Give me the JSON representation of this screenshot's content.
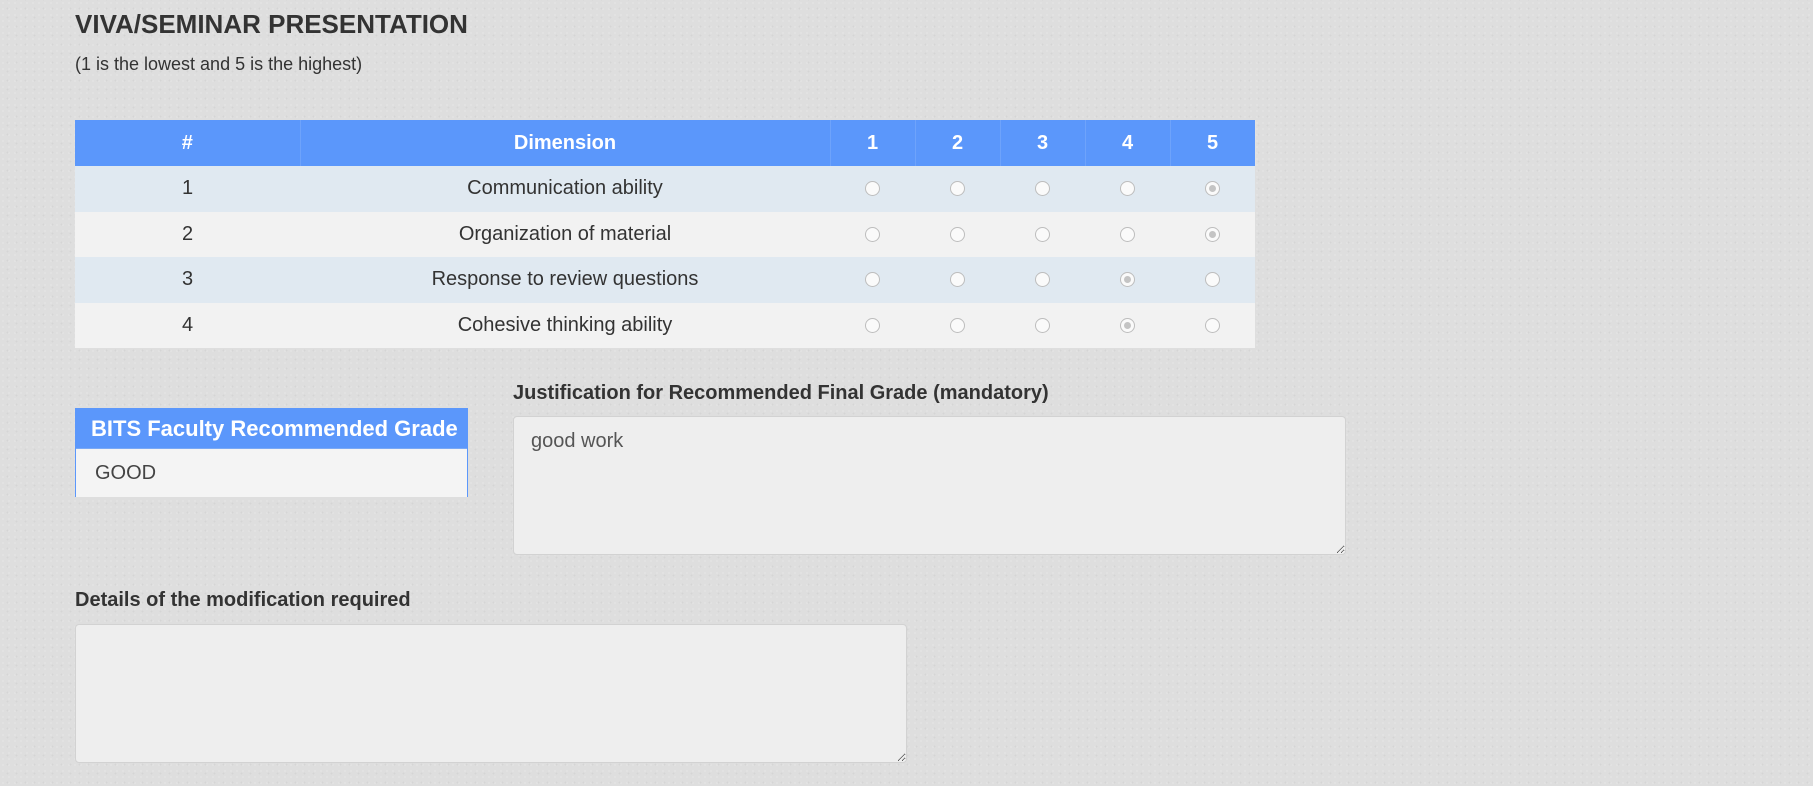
{
  "section": {
    "title": "VIVA/SEMINAR PRESENTATION",
    "subtitle": "(1 is the lowest and 5 is the highest)"
  },
  "rating_table": {
    "columns": [
      "#",
      "Dimension",
      "1",
      "2",
      "3",
      "4",
      "5"
    ],
    "rows": [
      {
        "number": "1",
        "dimension": "Communication ability",
        "selected": 5
      },
      {
        "number": "2",
        "dimension": "Organization of material",
        "selected": 5
      },
      {
        "number": "3",
        "dimension": "Response to review questions",
        "selected": 4
      },
      {
        "number": "4",
        "dimension": "Cohesive thinking ability",
        "selected": 4
      }
    ]
  },
  "grade": {
    "header": "BITS Faculty Recommended Grade",
    "value": "GOOD"
  },
  "justification": {
    "label": "Justification for Recommended Final Grade (mandatory)",
    "value": "good work"
  },
  "modification": {
    "label": "Details of the modification required",
    "value": ""
  },
  "colors": {
    "accent": "#5b97fb",
    "row_odd": "#e0e9f1",
    "row_even": "#f2f2f2",
    "background": "#dedede"
  },
  "icons": {
    "radio_unchecked": "radio-button-unchecked",
    "radio_checked": "radio-button-checked",
    "resize_handle": "textarea-resize-grip"
  }
}
